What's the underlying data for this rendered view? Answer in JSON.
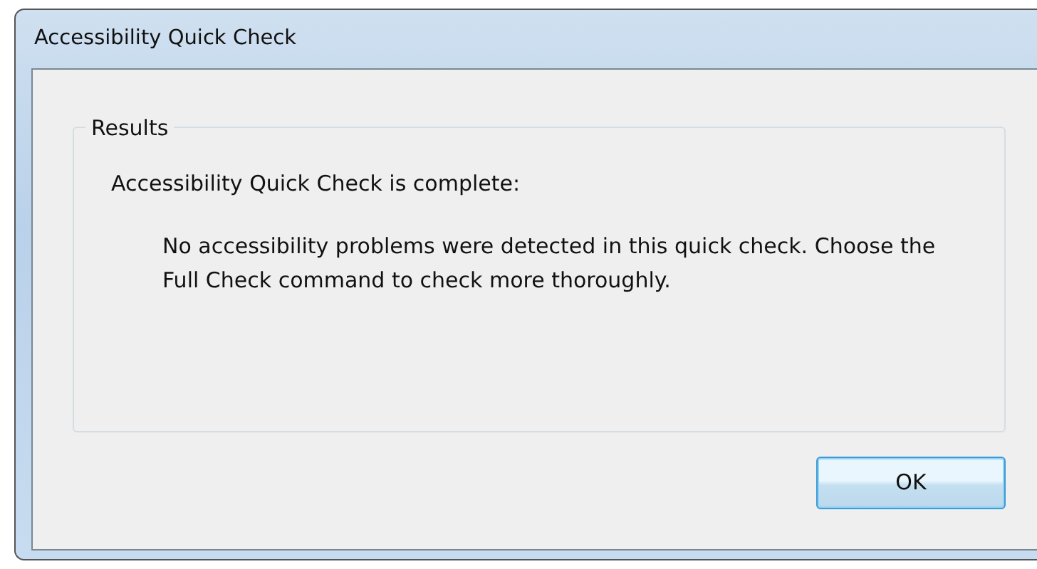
{
  "window": {
    "title": "Accessibility Quick Check"
  },
  "results": {
    "legend": "Results",
    "heading": "Accessibility Quick Check is complete:",
    "message": "No accessibility problems were detected in this quick check. Choose the Full Check command to check more thoroughly."
  },
  "buttons": [
    {
      "label": "OK",
      "default": true
    }
  ]
}
